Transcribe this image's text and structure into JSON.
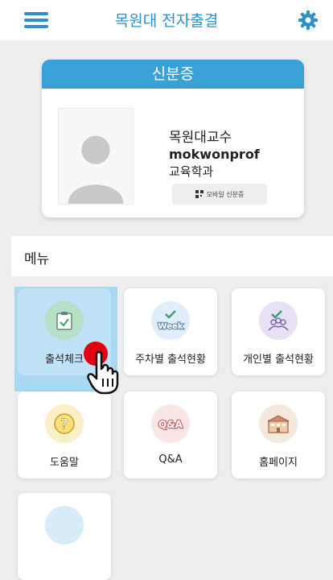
{
  "header": {
    "title": "목원대 전자출결",
    "menu_icon": "hamburger-icon",
    "settings_icon": "gear-icon"
  },
  "id_card": {
    "title": "신분증",
    "name": "목원대교수",
    "user_id": "mokwonprof",
    "department": "교육학과",
    "mobile_button": "모바일 신분증"
  },
  "menu": {
    "heading": "메뉴",
    "items": [
      {
        "label": "출석체크",
        "icon": "clipboard-check-icon",
        "selected": true
      },
      {
        "label": "주차별 출석현황",
        "icon": "week-icon"
      },
      {
        "label": "개인별 출석현황",
        "icon": "people-check-icon"
      },
      {
        "label": "도움말",
        "icon": "question-icon"
      },
      {
        "label": "Q&A",
        "icon": "qna-icon"
      },
      {
        "label": "홈페이지",
        "icon": "school-building-icon"
      }
    ]
  },
  "colors": {
    "accent": "#2f8fc7",
    "card_header": "#3aa1d6",
    "selected_tile": "#bfe2f6"
  }
}
